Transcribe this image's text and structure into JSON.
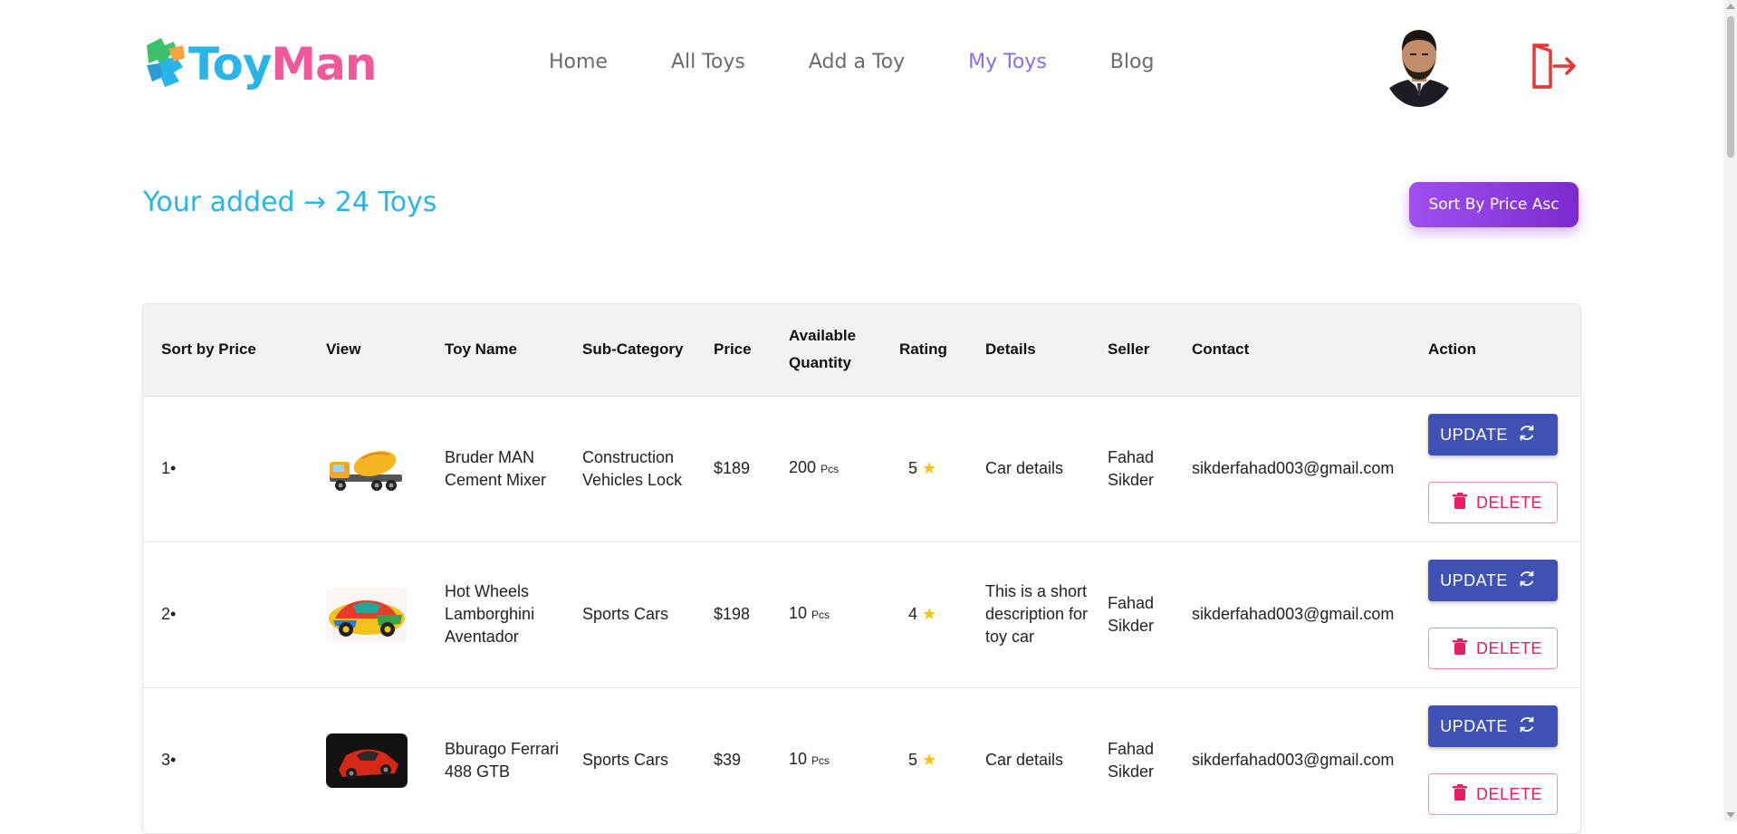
{
  "brand": {
    "part1": "Toy",
    "part2": "Man"
  },
  "nav": [
    {
      "label": "Home",
      "active": false
    },
    {
      "label": "All Toys",
      "active": false
    },
    {
      "label": "Add a Toy",
      "active": false
    },
    {
      "label": "My Toys",
      "active": true
    },
    {
      "label": "Blog",
      "active": false
    }
  ],
  "heading": {
    "text": "Your added → 24 Toys"
  },
  "sort_button": {
    "label": "Sort By Price Asc"
  },
  "table": {
    "headers": {
      "sort": "Sort by Price",
      "view": "View",
      "name": "Toy Name",
      "subcat": "Sub-Category",
      "price": "Price",
      "qty": "Available Quantity",
      "rating": "Rating",
      "details": "Details",
      "seller": "Seller",
      "contact": "Contact",
      "action": "Action"
    },
    "rows": [
      {
        "index": "1•",
        "image": "cement-mixer-truck",
        "name": "Bruder MAN Cement Mixer",
        "subcategory": "Construction Vehicles Lock",
        "price": "$189",
        "quantity": "200",
        "unit": "Pcs",
        "rating": "5",
        "details": "Car details",
        "seller": "Fahad Sikder",
        "contact": "sikderfahad003@gmail.com",
        "update_label": "UPDATE",
        "delete_label": "DELETE"
      },
      {
        "index": "2•",
        "image": "colorful-toy-car",
        "name": "Hot Wheels Lamborghini Aventador",
        "subcategory": "Sports Cars",
        "price": "$198",
        "quantity": "10",
        "unit": "Pcs",
        "rating": "4",
        "details": "This is a short description for toy car",
        "seller": "Fahad Sikder",
        "contact": "sikderfahad003@gmail.com",
        "update_label": "UPDATE",
        "delete_label": "DELETE"
      },
      {
        "index": "3•",
        "image": "red-ferrari-model",
        "name": "Bburago Ferrari 488 GTB",
        "subcategory": "Sports Cars",
        "price": "$39",
        "quantity": "10",
        "unit": "Pcs",
        "rating": "5",
        "details": "Car details",
        "seller": "Fahad Sikder",
        "contact": "sikderfahad003@gmail.com",
        "update_label": "UPDATE",
        "delete_label": "DELETE"
      }
    ]
  },
  "icons": {
    "logo": "puzzle-logo-icon",
    "avatar": "user-avatar",
    "logout": "logout-icon",
    "update": "refresh-icon",
    "delete": "trash-icon",
    "rating": "star-icon"
  },
  "colors": {
    "brand_blue": "#29b6e6",
    "brand_pink": "#f0589a",
    "nav_active": "#8b6cf0",
    "update_button": "#3f51b5",
    "delete_button": "#e91e63",
    "sort_button": "#8a3de0",
    "logout": "#e53935",
    "star": "#f5c400"
  }
}
